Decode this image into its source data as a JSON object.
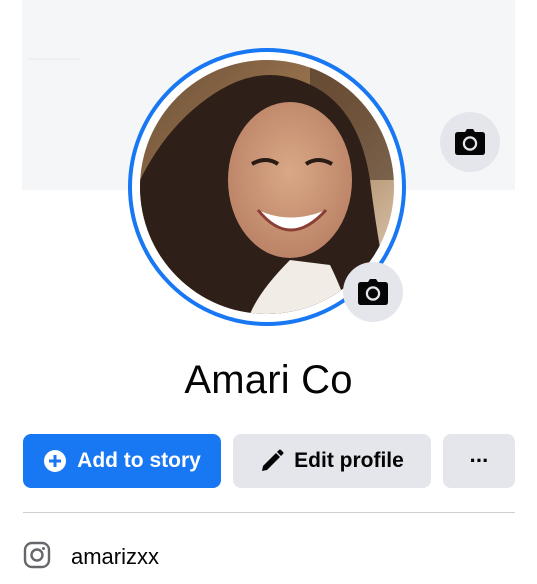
{
  "profile": {
    "name": "Amari Co",
    "avatar_alt": "profile photo"
  },
  "actions": {
    "add_story_label": "Add to story",
    "edit_profile_label": "Edit profile",
    "more_label": "···"
  },
  "links": {
    "instagram_handle": "amarizxx"
  },
  "icons": {
    "cover_camera": "camera-icon",
    "avatar_camera": "camera-icon",
    "add": "plus-circle-icon",
    "edit": "pencil-icon",
    "instagram": "instagram-icon"
  },
  "colors": {
    "accent": "#1877f2",
    "secondary_button": "#e4e6eb",
    "text": "#050505"
  }
}
